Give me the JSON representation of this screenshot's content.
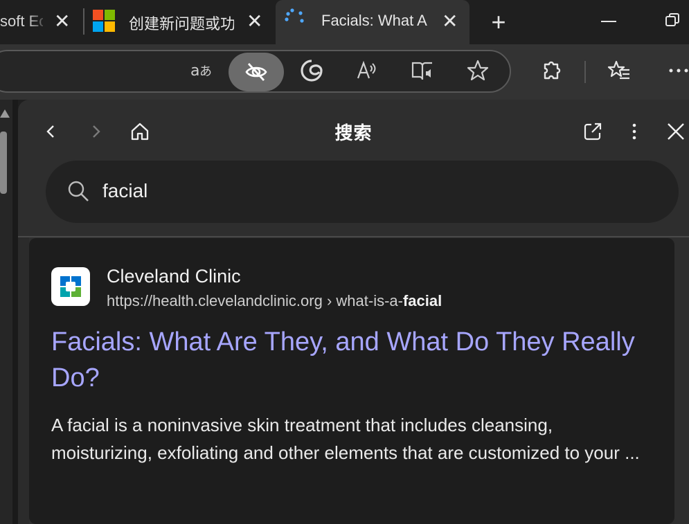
{
  "tabs": [
    {
      "title": "soft Ec",
      "active": false
    },
    {
      "title": "创建新问题或功",
      "active": false
    },
    {
      "title": "Facials: What A",
      "active": true
    }
  ],
  "colors": {
    "accent_link": "#a7a6ff",
    "panel_bg": "#2e2e2e",
    "card_bg": "#1d1d1d",
    "toolbar_bg": "#333333"
  },
  "toolbar": {
    "icons": [
      "translate-icon",
      "tracking-prevention-icon",
      "edge-copilot-icon",
      "read-aloud-icon",
      "immersive-reader-icon",
      "add-favorite-icon",
      "extensions-icon",
      "favorites-icon",
      "more-icon"
    ]
  },
  "sidebar": {
    "title": "搜索",
    "search_query": "facial"
  },
  "result": {
    "site_name": "Cleveland Clinic",
    "url_prefix": "https://health.clevelandclinic.org › what-is-a-",
    "url_bold": "facial",
    "title": "Facials: What Are They, and What Do They Really Do?",
    "snippet": "A facial is a noninvasive skin treatment that includes cleansing, moisturizing, exfoliating and other elements that are customized to your ..."
  }
}
